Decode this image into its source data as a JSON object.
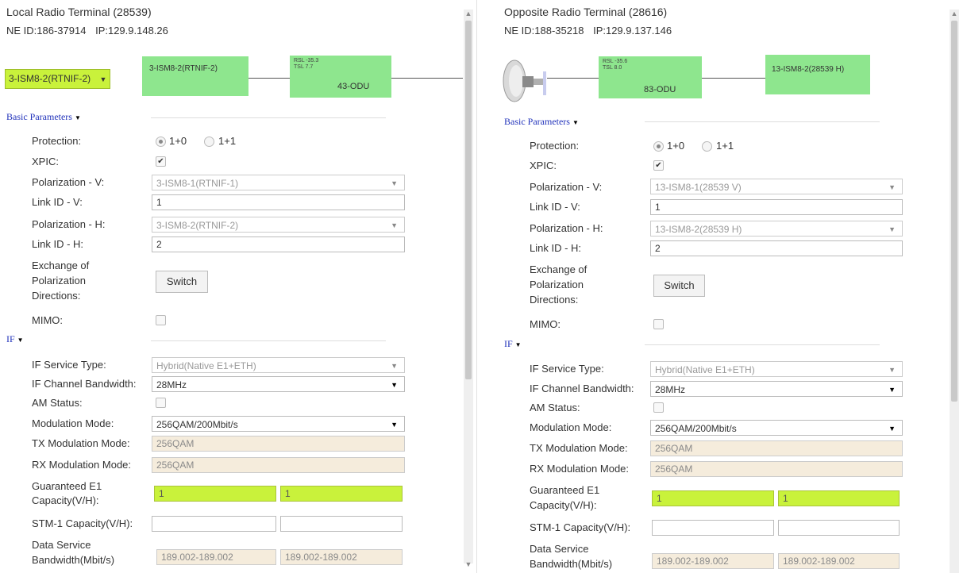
{
  "left": {
    "title": "Local Radio Terminal (28539)",
    "ne_id": "NE ID:186-37914",
    "ip": "IP:129.9.148.26",
    "board_select": "3-ISM8-2(RTNIF-2)",
    "board_box": "3-ISM8-2(RTNIF-2)",
    "odu_rsl": "RSL -35.3",
    "odu_tsl": "TSL 7.7",
    "odu_label": "43-ODU",
    "basic": {
      "header": "Basic Parameters",
      "protection_label": "Protection:",
      "opt_1p0": "1+0",
      "opt_1p1": "1+1",
      "xpic_label": "XPIC:",
      "pol_v_label": "Polarization - V:",
      "pol_v_value": "3-ISM8-1(RTNIF-1)",
      "link_v_label": "Link ID - V:",
      "link_v_value": "1",
      "pol_h_label": "Polarization - H:",
      "pol_h_value": "3-ISM8-2(RTNIF-2)",
      "link_h_label": "Link ID - H:",
      "link_h_value": "2",
      "exch_line1": "Exchange of",
      "exch_line2": "Polarization",
      "exch_line3": "Directions:",
      "switch_label": "Switch",
      "mimo_label": "MIMO:"
    },
    "if": {
      "header": "IF",
      "service_type_label": "IF Service Type:",
      "service_type_value": "Hybrid(Native E1+ETH)",
      "bandwidth_label": "IF Channel Bandwidth:",
      "bandwidth_value": "28MHz",
      "am_label": "AM Status:",
      "mod_mode_label": "Modulation Mode:",
      "mod_mode_value": "256QAM/200Mbit/s",
      "tx_label": "TX Modulation Mode:",
      "tx_value": "256QAM",
      "rx_label": "RX Modulation Mode:",
      "rx_value": "256QAM",
      "ge1_line1": "Guaranteed E1",
      "ge1_line2": "Capacity(V/H):",
      "ge1_v": "1",
      "ge1_h": "1",
      "stm1_label": "STM-1 Capacity(V/H):",
      "ds_line1": "Data Service",
      "ds_line2": "Bandwidth(Mbit/s)",
      "ds_v": "189.002-189.002",
      "ds_h": "189.002-189.002"
    }
  },
  "right": {
    "title": "Opposite Radio Terminal (28616)",
    "ne_id": "NE ID:188-35218",
    "ip": "IP:129.9.137.146",
    "odu_rsl": "RSL -35.6",
    "odu_tsl": "TSL 8.0",
    "odu_label": "83-ODU",
    "board_box": "13-ISM8-2(28539 H)",
    "basic": {
      "header": "Basic Parameters",
      "protection_label": "Protection:",
      "opt_1p0": "1+0",
      "opt_1p1": "1+1",
      "xpic_label": "XPIC:",
      "pol_v_label": "Polarization - V:",
      "pol_v_value": "13-ISM8-1(28539 V)",
      "link_v_label": "Link ID - V:",
      "link_v_value": "1",
      "pol_h_label": "Polarization - H:",
      "pol_h_value": "13-ISM8-2(28539 H)",
      "link_h_label": "Link ID - H:",
      "link_h_value": "2",
      "exch_line1": "Exchange of",
      "exch_line2": "Polarization",
      "exch_line3": "Directions:",
      "switch_label": "Switch",
      "mimo_label": "MIMO:"
    },
    "if": {
      "header": "IF",
      "service_type_label": "IF Service Type:",
      "service_type_value": "Hybrid(Native E1+ETH)",
      "bandwidth_label": "IF Channel Bandwidth:",
      "bandwidth_value": "28MHz",
      "am_label": "AM Status:",
      "mod_mode_label": "Modulation Mode:",
      "mod_mode_value": "256QAM/200Mbit/s",
      "tx_label": "TX Modulation Mode:",
      "tx_value": "256QAM",
      "rx_label": "RX Modulation Mode:",
      "rx_value": "256QAM",
      "ge1_line1": "Guaranteed E1",
      "ge1_line2": "Capacity(V/H):",
      "ge1_v": "1",
      "ge1_h": "1",
      "stm1_label": "STM-1 Capacity(V/H):",
      "ds_line1": "Data Service",
      "ds_line2": "Bandwidth(Mbit/s)",
      "ds_v": "189.002-189.002",
      "ds_h": "189.002-189.002"
    }
  },
  "icons": {
    "dropdown_caret": "▼",
    "section_caret": "▼",
    "check_mark": "✔",
    "scroll_up": "▲",
    "scroll_down": "▼"
  }
}
